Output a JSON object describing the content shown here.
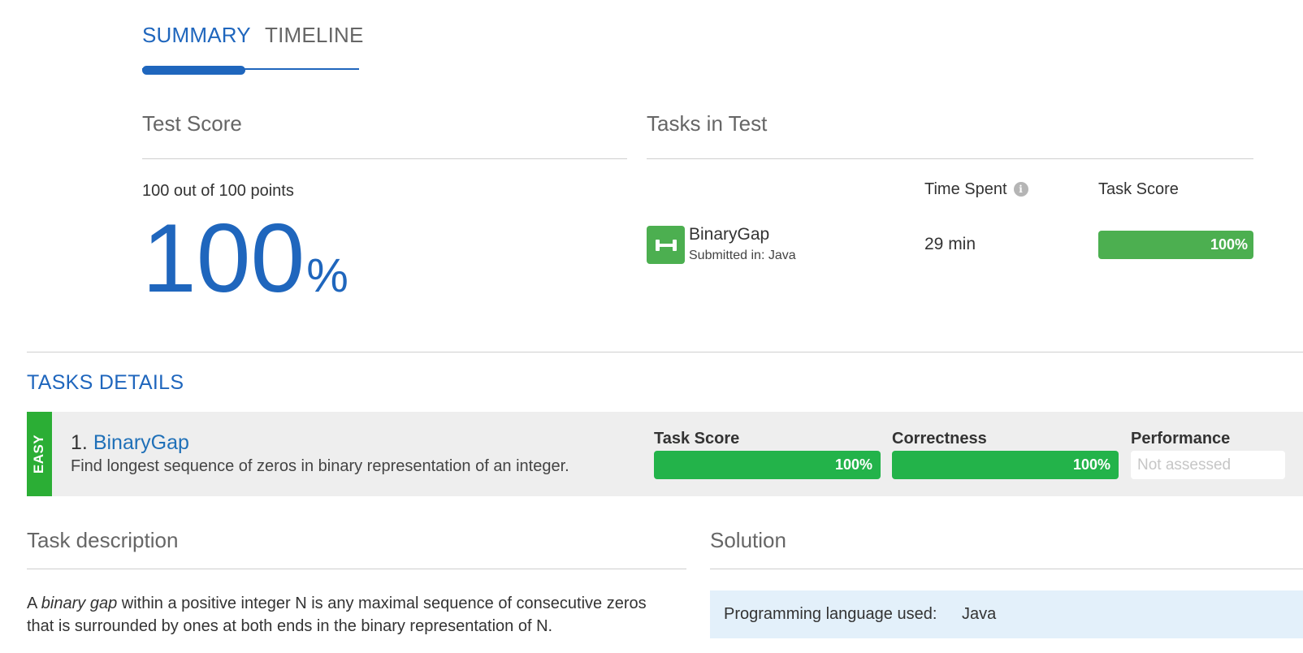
{
  "tabs": {
    "summary_label": "SUMMARY",
    "timeline_label": "TIMELINE",
    "active": "SUMMARY"
  },
  "test_score": {
    "heading": "Test Score",
    "points_text": "100 out of 100 points",
    "percent_value": "100",
    "percent_sign": "%"
  },
  "tasks_in_test": {
    "heading": "Tasks in Test",
    "columns": {
      "time_spent": "Time Spent",
      "task_score": "Task Score"
    },
    "task": {
      "icon": "dumbbell-icon",
      "name": "BinaryGap",
      "submitted_in": "Submitted in: Java",
      "time_spent": "29 min",
      "score_label": "100%",
      "score_fraction": 1.0
    }
  },
  "tasks_details": {
    "heading": "TASKS DETAILS",
    "card": {
      "difficulty": "EASY",
      "number": "1.",
      "name": "BinaryGap",
      "description": "Find longest sequence of zeros in binary representation of an integer.",
      "metrics": {
        "task_score": {
          "label": "Task Score",
          "value": "100%",
          "fraction": 1.0
        },
        "correctness": {
          "label": "Correctness",
          "value": "100%",
          "fraction": 1.0
        },
        "performance": {
          "label": "Performance",
          "value": "Not assessed"
        }
      }
    }
  },
  "task_description": {
    "heading": "Task description",
    "para_prefix": "A ",
    "para_italic": "binary gap",
    "para_suffix": " within a positive integer N is any maximal sequence of consecutive zeros that is surrounded by ones at both ends in the binary representation of N."
  },
  "solution": {
    "heading": "Solution",
    "language_label": "Programming language used:",
    "language_value": "Java"
  },
  "colors": {
    "accent": "#1f66bd",
    "success": "#4caf50",
    "success_bright": "#23b34a",
    "easy_tag": "#2bae35",
    "card_bg": "#eeeeee",
    "info_box_bg": "#e3f0fa"
  }
}
